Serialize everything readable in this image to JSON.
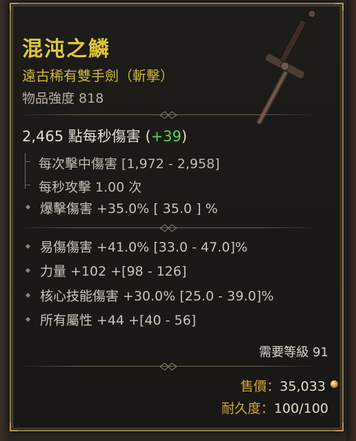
{
  "item": {
    "name": "混沌之鱗",
    "type_line": "遠古稀有雙手劍（斬擊）",
    "item_power": "物品強度 818"
  },
  "dps": {
    "value_text": "2,465 點每秒傷害",
    "bonus_open": "(",
    "bonus": "+39",
    "bonus_close": ")"
  },
  "weapon_stats": [
    "每次擊中傷害 [1,972 - 2,958]",
    "每秒攻擊 1.00 次"
  ],
  "implicit": "爆擊傷害 +35.0%  [ 35.0 ] %",
  "affixes": [
    "易傷傷害 +41.0% [33.0 - 47.0]%",
    "力量 +102 +[98 - 126]",
    "核心技能傷害 +30.0% [25.0 - 39.0]%",
    "所有屬性 +44 +[40 - 56]"
  ],
  "requirement": "需要等級 91",
  "price": {
    "label": "售價：",
    "value": "35,033"
  },
  "durability": {
    "label": "耐久度：",
    "value": "100/100"
  },
  "colors": {
    "legendary_name": "#dcc637",
    "bonus_green": "#59d64f",
    "frame": "#8b7a57"
  }
}
